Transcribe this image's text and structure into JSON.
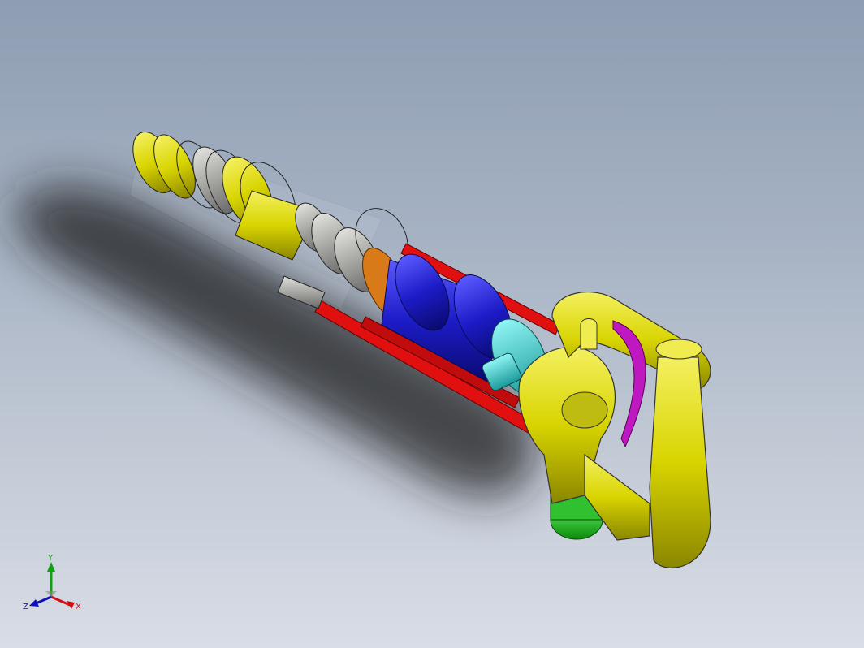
{
  "viewport": {
    "background_top": "#8e9db2",
    "background_bottom": "#d8dde6"
  },
  "model": {
    "colors": {
      "yellow": "#d8d400",
      "yellow_dark": "#8a8600",
      "blue": "#1c1cc8",
      "cyan": "#28c8c8",
      "orange": "#d87a18",
      "red": "#e01010",
      "magenta": "#c018c0",
      "green": "#18c818",
      "gray": "#9a9a98"
    }
  },
  "triad": {
    "y_label": "Y",
    "x_label": "X",
    "z_label": "Z",
    "y_color": "#10a010",
    "x_color": "#d01010",
    "z_color": "#1010c0"
  }
}
